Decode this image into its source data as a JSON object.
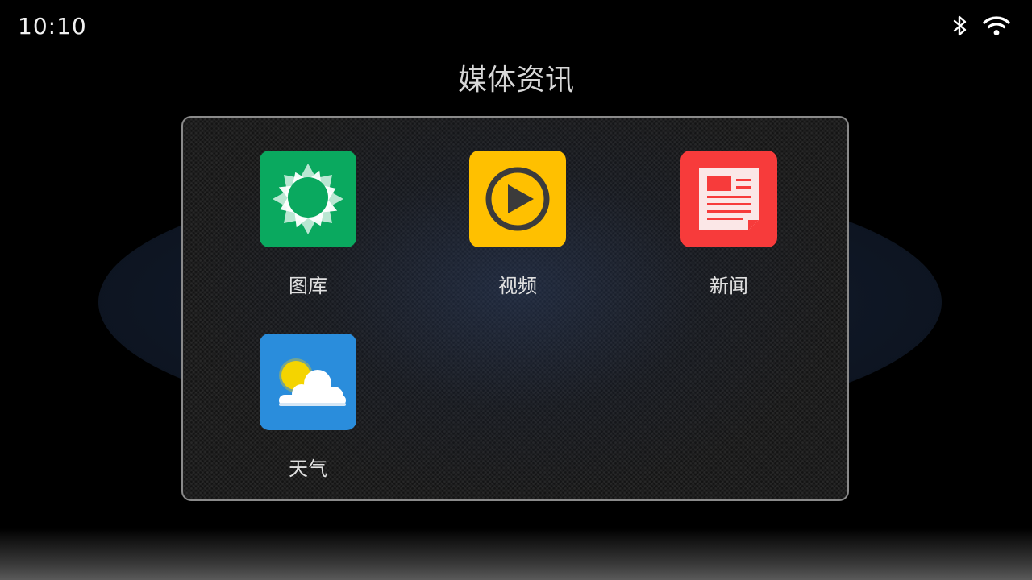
{
  "status_bar": {
    "time": "10:10",
    "icons": [
      "bluetooth-icon",
      "wifi-icon"
    ]
  },
  "page": {
    "title": "媒体资讯"
  },
  "apps": [
    {
      "label": "图库",
      "icon": "gallery-icon",
      "color": "#0aa95f"
    },
    {
      "label": "视频",
      "icon": "video-icon",
      "color": "#ffc000"
    },
    {
      "label": "新闻",
      "icon": "news-icon",
      "color": "#f73b3b"
    },
    {
      "label": "天气",
      "icon": "weather-icon",
      "color": "#2a8ddc"
    }
  ]
}
